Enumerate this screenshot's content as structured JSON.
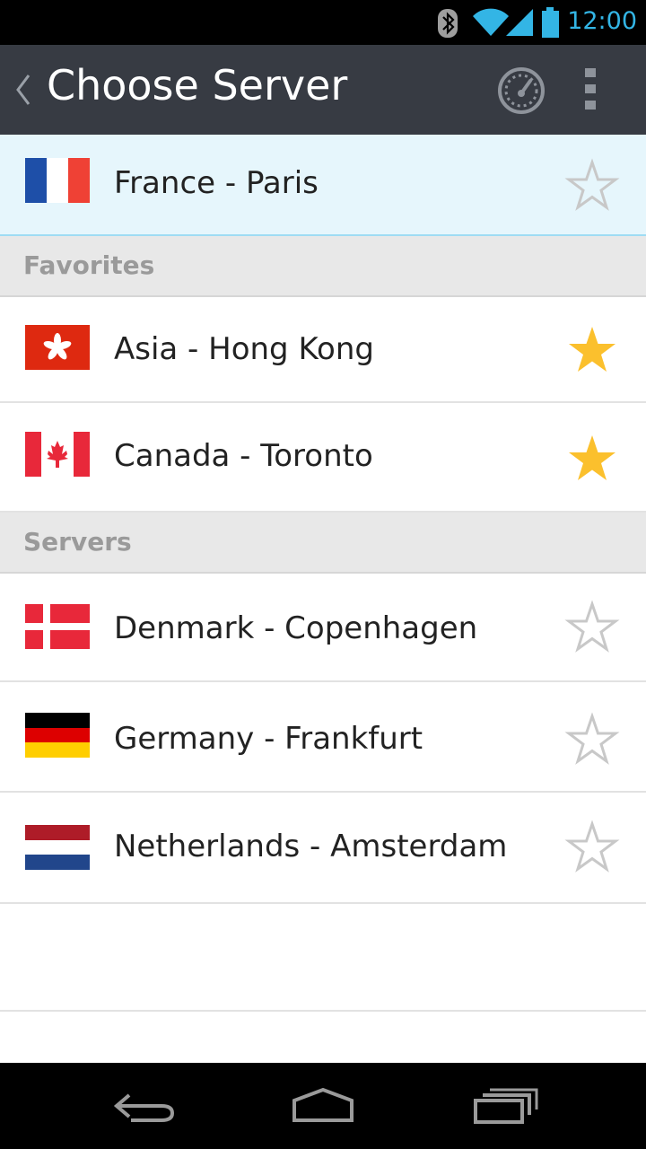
{
  "status_bar": {
    "time": "12:00",
    "accent": "#33b5e5"
  },
  "action_bar": {
    "title": "Choose Server",
    "background": "#373b43"
  },
  "selected_server": {
    "label": "France - Paris",
    "flag": "france",
    "favorite": false
  },
  "sections": [
    {
      "title": "Favorites",
      "items": [
        {
          "label": "Asia - Hong Kong",
          "flag": "hong-kong",
          "favorite": true
        },
        {
          "label": "Canada - Toronto",
          "flag": "canada",
          "favorite": true
        }
      ]
    },
    {
      "title": "Servers",
      "items": [
        {
          "label": "Denmark - Copenhagen",
          "flag": "denmark",
          "favorite": false
        },
        {
          "label": "Germany - Frankfurt",
          "flag": "germany",
          "favorite": false
        },
        {
          "label": "Netherlands - Amsterdam",
          "flag": "netherlands",
          "favorite": false
        }
      ]
    }
  ],
  "colors": {
    "star_on": "#fbc02d",
    "star_off": "#c8c8c8",
    "selected_bg": "#e6f6fc"
  }
}
